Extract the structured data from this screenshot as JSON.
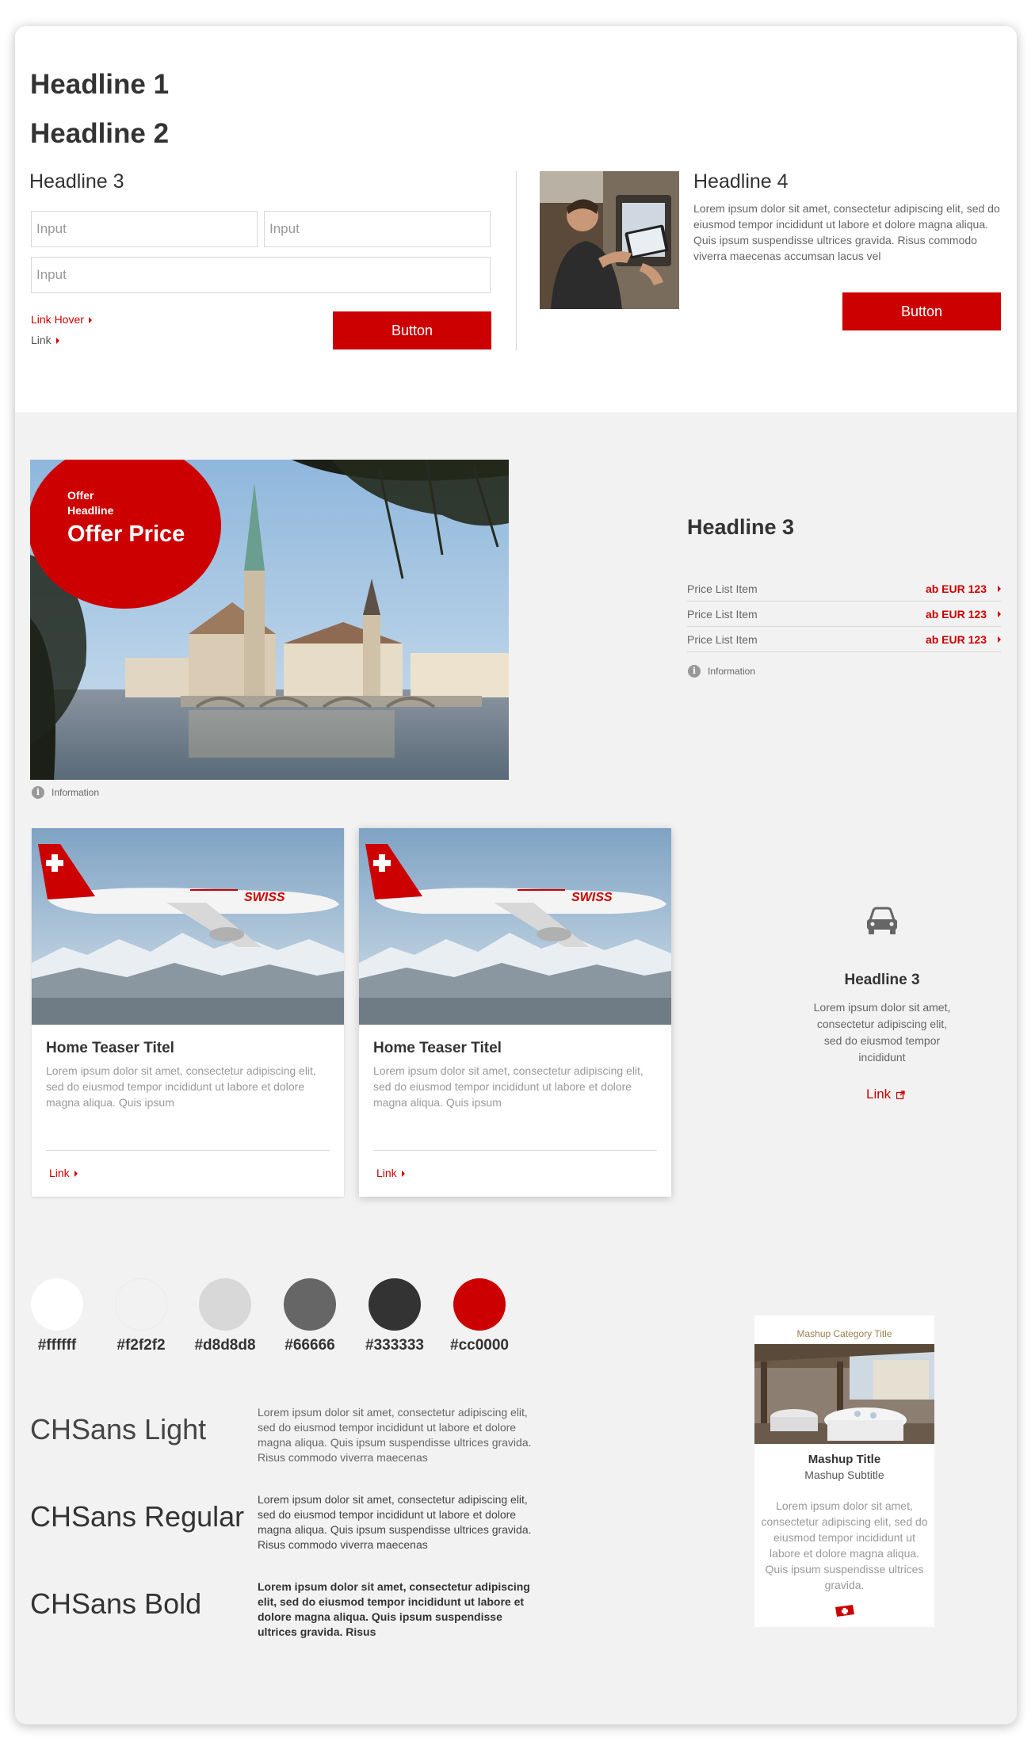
{
  "top": {
    "headline1": "Headline 1",
    "headline2": "Headline 2",
    "headline3": "Headline 3",
    "input1_placeholder": "Input",
    "input2_placeholder": "Input",
    "input3_placeholder": "Input",
    "link_hover": "Link Hover",
    "link": "Link",
    "button": "Button",
    "headline4": "Headline 4",
    "headline4_text": "Lorem ipsum dolor sit amet, consectetur adipiscing elit, sed do eiusmod tempor incididunt ut labore et dolore magna aliqua. Quis ipsum suspendisse ultrices gravida. Risus commodo viverra maecenas accumsan lacus vel",
    "button2": "Button"
  },
  "offer": {
    "label": "Offer Headline",
    "price": "Offer Price",
    "information": "Information"
  },
  "price_list": {
    "headline": "Headline 3",
    "items": [
      {
        "label": "Price List Item",
        "value": "ab EUR 123"
      },
      {
        "label": "Price List Item",
        "value": "ab EUR 123"
      },
      {
        "label": "Price List Item",
        "value": "ab EUR 123"
      }
    ],
    "information": "Information"
  },
  "teasers": [
    {
      "title": "Home Teaser Titel",
      "text": "Lorem ipsum dolor sit amet, consectetur adipiscing elit, sed do eiusmod tempor incididunt ut labore et dolore magna aliqua. Quis ipsum",
      "link": "Link",
      "plane_brand": "SWISS"
    },
    {
      "title": "Home Teaser Titel",
      "text": "Lorem ipsum dolor sit amet, consectetur adipiscing elit, sed do eiusmod tempor incididunt ut labore et dolore magna aliqua. Quis ipsum",
      "link": "Link",
      "plane_brand": "SWISS"
    }
  ],
  "icon_teaser": {
    "icon": "car-icon",
    "headline": "Headline 3",
    "text": "Lorem ipsum dolor sit amet, consectetur adipiscing elit, sed do eiusmod tempor incididunt",
    "link": "Link",
    "link_icon": "external-link-icon"
  },
  "colors": [
    {
      "hex": "#ffffff",
      "label": "#ffffff"
    },
    {
      "hex": "#f2f2f2",
      "label": "#f2f2f2"
    },
    {
      "hex": "#d8d8d8",
      "label": "#d8d8d8"
    },
    {
      "hex": "#666666",
      "label": "#66666"
    },
    {
      "hex": "#333333",
      "label": "#333333"
    },
    {
      "hex": "#cc0000",
      "label": "#cc0000"
    }
  ],
  "fonts": [
    {
      "name": "CHSans Light",
      "sample": "Lorem ipsum dolor sit amet, consectetur adipiscing elit, sed do eiusmod tempor incididunt ut labore et dolore magna aliqua. Quis ipsum suspendisse ultrices gravida. Risus commodo viverra maecenas"
    },
    {
      "name": "CHSans Regular",
      "sample": "Lorem ipsum dolor sit amet, consectetur adipiscing elit, sed do eiusmod tempor incididunt ut labore et dolore magna aliqua. Quis ipsum suspendisse ultrices gravida. Risus commodo viverra maecenas"
    },
    {
      "name": "CHSans Bold",
      "sample": "Lorem ipsum dolor sit amet, consectetur adipiscing elit, sed do eiusmod tempor incididunt ut labore et dolore magna aliqua. Quis ipsum suspendisse ultrices gravida. Risus"
    }
  ],
  "mashup": {
    "category": "Mashup Category Title",
    "title": "Mashup Title",
    "subtitle": "Mashup Subtitle",
    "text": "Lorem ipsum dolor sit amet, consectetur adipiscing elit, sed do eiusmod tempor incididunt ut labore et dolore magna aliqua. Quis ipsum suspendisse ultrices gravida.",
    "flag_icon": "swiss-flag-icon"
  }
}
